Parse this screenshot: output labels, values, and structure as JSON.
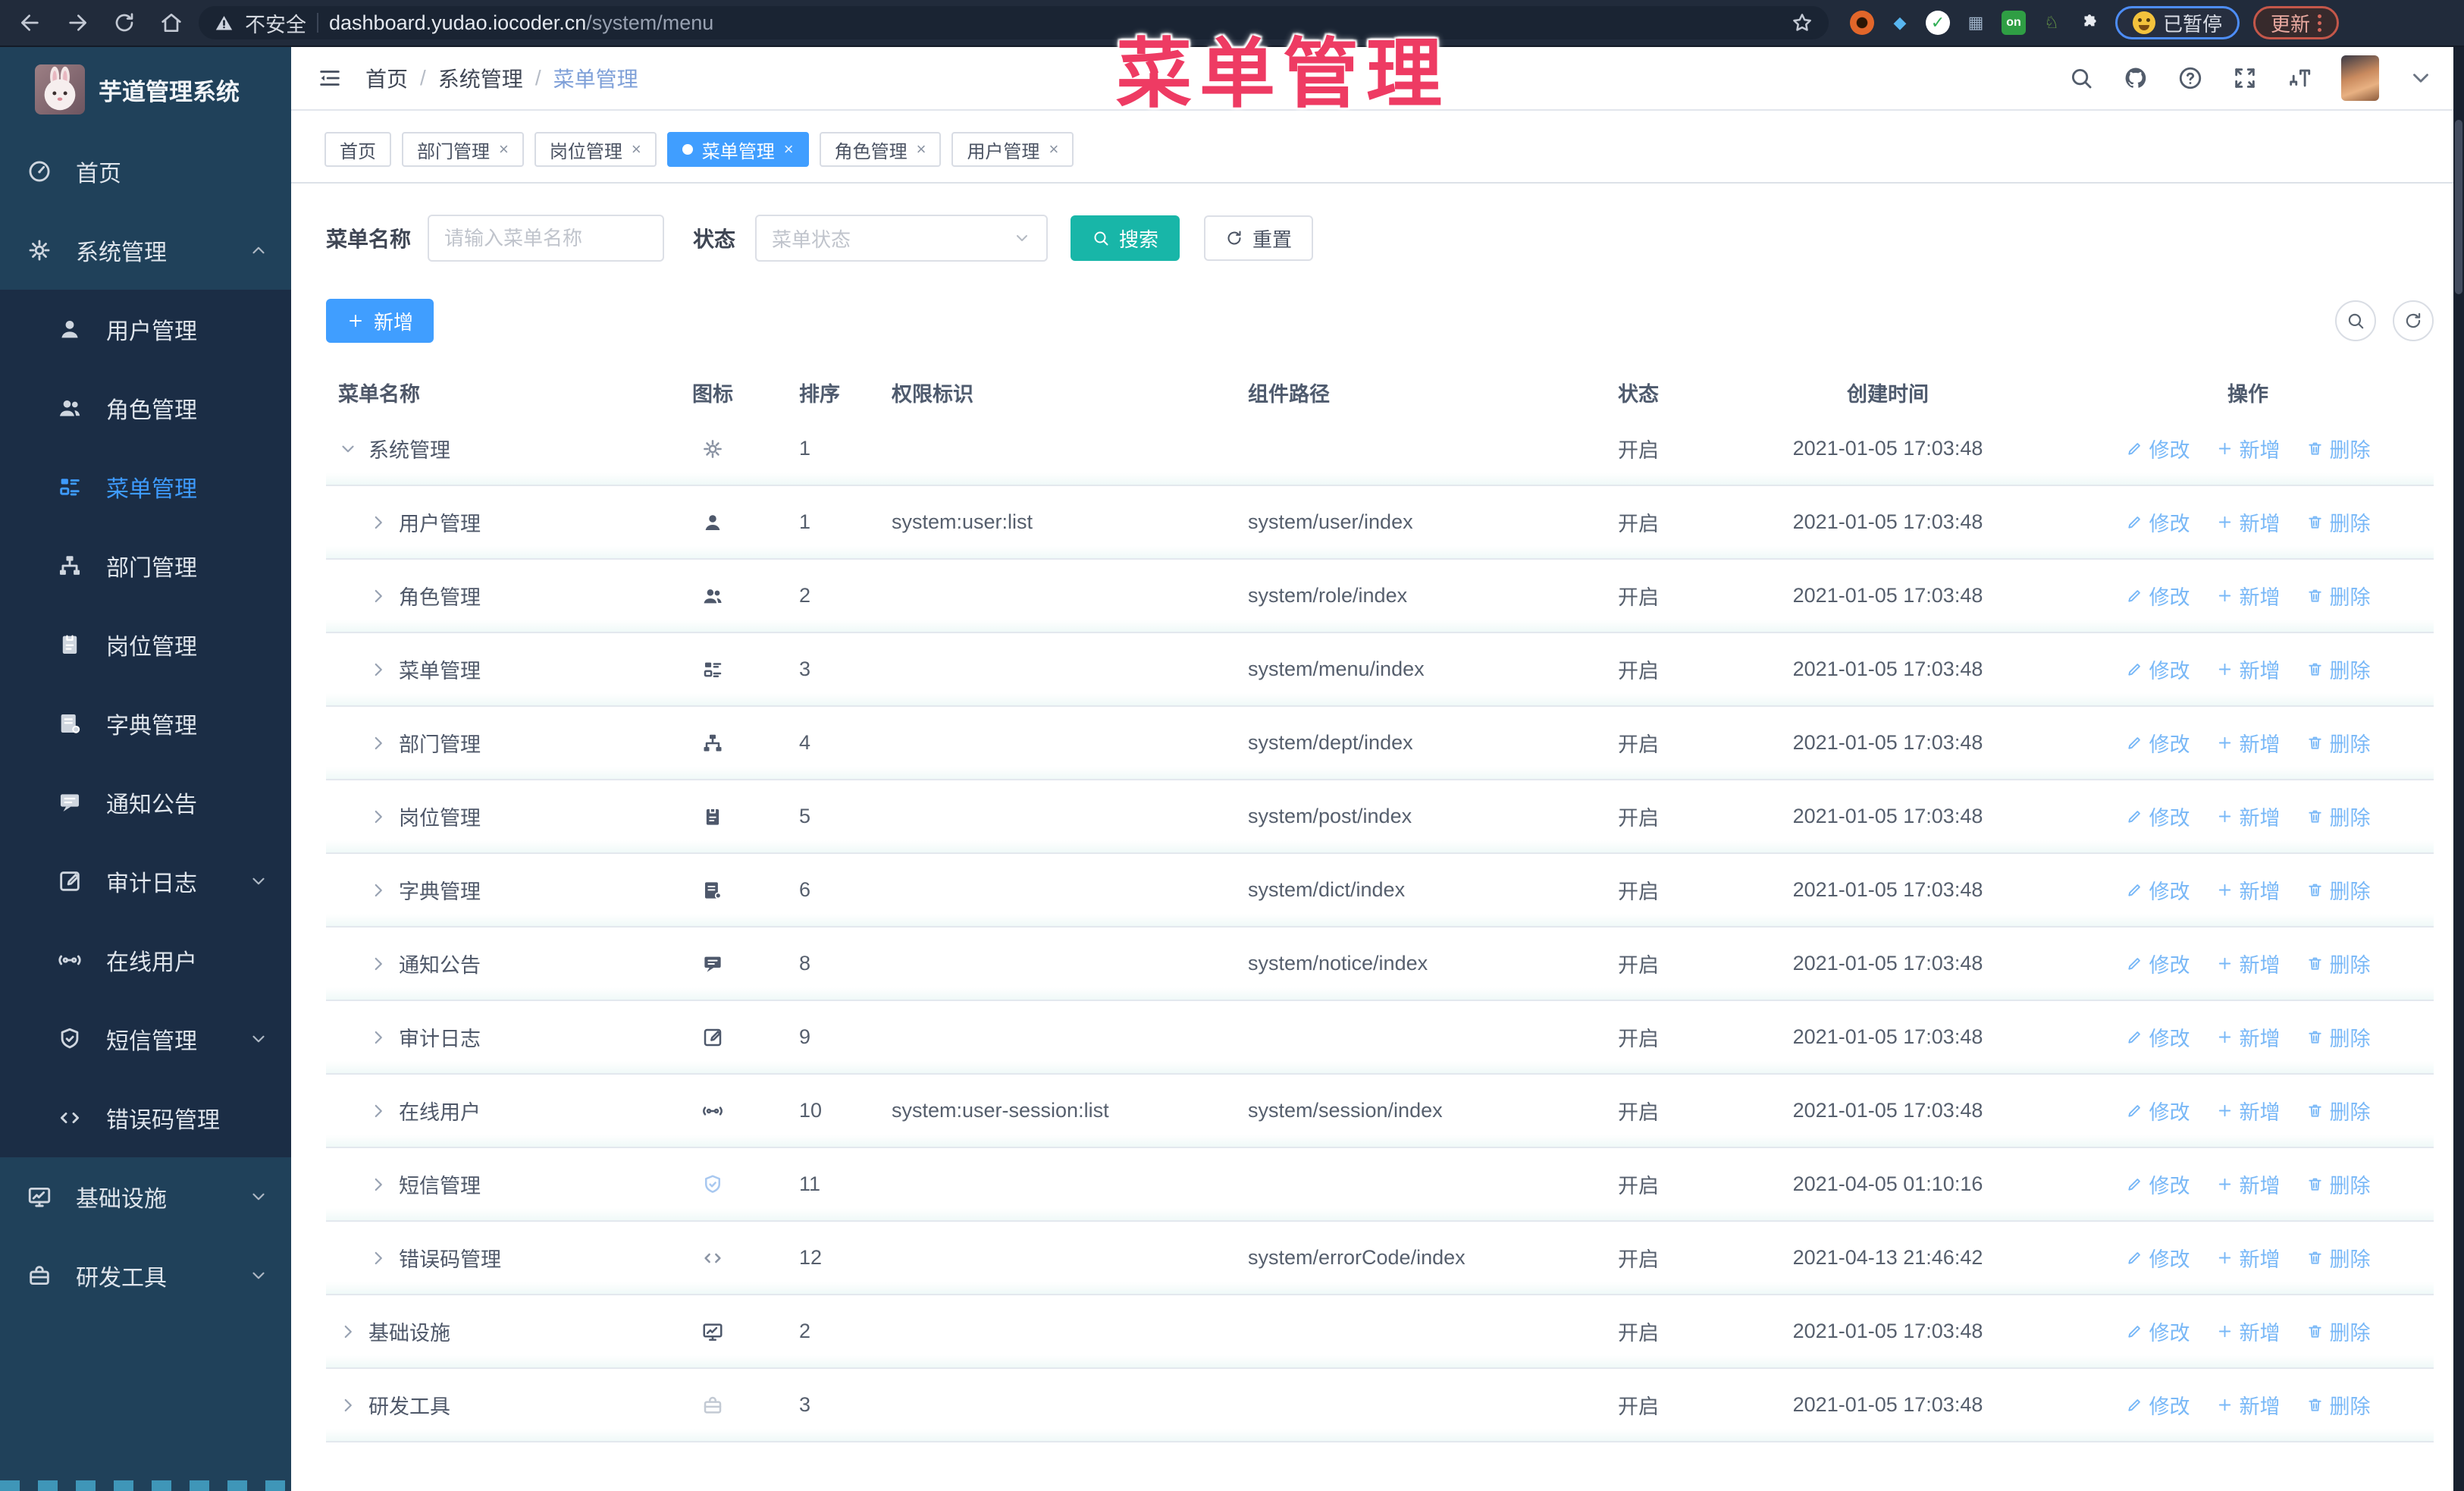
{
  "overlay_title": "菜单管理",
  "colors": {
    "accent_blue": "#409eff",
    "search_teal": "#18b6a8",
    "overlay_red": "#ee3b63",
    "sidebar_bg": "#20415a",
    "submenu_bg": "#1b2d45",
    "active_menu_text": "#3e9bff"
  },
  "browser": {
    "security_label": "不安全",
    "url_host": "dashboard.yudao.iocoder.cn",
    "url_path": "/system/menu",
    "on_badge": "on",
    "paused_badge": "已暂停",
    "update_badge": "更新"
  },
  "sidebar": {
    "app_title": "芋道管理系统",
    "menu": [
      {
        "key": "home",
        "label": "首页",
        "icon": "gauge",
        "level": 0
      },
      {
        "key": "system",
        "label": "系统管理",
        "icon": "gear",
        "level": 0,
        "chevron": "up",
        "expanded": true
      },
      {
        "key": "user",
        "label": "用户管理",
        "icon": "user",
        "level": 1
      },
      {
        "key": "role",
        "label": "角色管理",
        "icon": "users",
        "level": 1
      },
      {
        "key": "menu",
        "label": "菜单管理",
        "icon": "menu",
        "level": 1,
        "active": true
      },
      {
        "key": "dept",
        "label": "部门管理",
        "icon": "tree",
        "level": 1
      },
      {
        "key": "post",
        "label": "岗位管理",
        "icon": "badge",
        "level": 1
      },
      {
        "key": "dict",
        "label": "字典管理",
        "icon": "book",
        "level": 1
      },
      {
        "key": "notice",
        "label": "通知公告",
        "icon": "notice",
        "level": 1
      },
      {
        "key": "auditlog",
        "label": "审计日志",
        "icon": "log",
        "level": 1,
        "chevron": "down"
      },
      {
        "key": "online",
        "label": "在线用户",
        "icon": "link",
        "level": 1
      },
      {
        "key": "sms",
        "label": "短信管理",
        "icon": "shield",
        "level": 1,
        "chevron": "down"
      },
      {
        "key": "errorcode",
        "label": "错误码管理",
        "icon": "code",
        "level": 1
      },
      {
        "key": "infra",
        "label": "基础设施",
        "icon": "monitor",
        "level": 0,
        "chevron": "down"
      },
      {
        "key": "devtool",
        "label": "研发工具",
        "icon": "toolbox",
        "level": 0,
        "chevron": "down"
      }
    ]
  },
  "header": {
    "breadcrumb": [
      "首页",
      "系统管理",
      "菜单管理"
    ]
  },
  "tabs": [
    {
      "key": "home",
      "label": "首页",
      "closable": false,
      "active": false
    },
    {
      "key": "dept",
      "label": "部门管理",
      "closable": true,
      "active": false
    },
    {
      "key": "post",
      "label": "岗位管理",
      "closable": true,
      "active": false
    },
    {
      "key": "menu",
      "label": "菜单管理",
      "closable": true,
      "active": true
    },
    {
      "key": "role",
      "label": "角色管理",
      "closable": true,
      "active": false
    },
    {
      "key": "user",
      "label": "用户管理",
      "closable": true,
      "active": false
    }
  ],
  "filters": {
    "name_label": "菜单名称",
    "name_placeholder": "请输入菜单名称",
    "name_value": "",
    "status_label": "状态",
    "status_placeholder": "菜单状态",
    "search_label": "搜索",
    "reset_label": "重置"
  },
  "toolbar": {
    "add_label": "新增"
  },
  "table": {
    "columns": [
      "菜单名称",
      "图标",
      "排序",
      "权限标识",
      "组件路径",
      "状态",
      "创建时间",
      "操作"
    ],
    "actions": {
      "edit": "修改",
      "add": "新增",
      "delete": "删除"
    },
    "rows": [
      {
        "key": "system",
        "name": "系统管理",
        "icon": "gear",
        "tone": "tone-light",
        "level": 0,
        "expand": "down",
        "sort": "1",
        "perm": "",
        "path": "",
        "status": "开启",
        "created": "2021-01-05 17:03:48"
      },
      {
        "key": "user",
        "name": "用户管理",
        "icon": "user",
        "tone": "",
        "level": 1,
        "expand": "right",
        "sort": "1",
        "perm": "system:user:list",
        "path": "system/user/index",
        "status": "开启",
        "created": "2021-01-05 17:03:48"
      },
      {
        "key": "role",
        "name": "角色管理",
        "icon": "users",
        "tone": "",
        "level": 1,
        "expand": "right",
        "sort": "2",
        "perm": "",
        "path": "system/role/index",
        "status": "开启",
        "created": "2021-01-05 17:03:48"
      },
      {
        "key": "menu",
        "name": "菜单管理",
        "icon": "menu",
        "tone": "",
        "level": 1,
        "expand": "right",
        "sort": "3",
        "perm": "",
        "path": "system/menu/index",
        "status": "开启",
        "created": "2021-01-05 17:03:48"
      },
      {
        "key": "dept",
        "name": "部门管理",
        "icon": "tree",
        "tone": "",
        "level": 1,
        "expand": "right",
        "sort": "4",
        "perm": "",
        "path": "system/dept/index",
        "status": "开启",
        "created": "2021-01-05 17:03:48"
      },
      {
        "key": "post",
        "name": "岗位管理",
        "icon": "badge",
        "tone": "",
        "level": 1,
        "expand": "right",
        "sort": "5",
        "perm": "",
        "path": "system/post/index",
        "status": "开启",
        "created": "2021-01-05 17:03:48"
      },
      {
        "key": "dict",
        "name": "字典管理",
        "icon": "book",
        "tone": "",
        "level": 1,
        "expand": "right",
        "sort": "6",
        "perm": "",
        "path": "system/dict/index",
        "status": "开启",
        "created": "2021-01-05 17:03:48"
      },
      {
        "key": "notice",
        "name": "通知公告",
        "icon": "notice",
        "tone": "",
        "level": 1,
        "expand": "right",
        "sort": "8",
        "perm": "",
        "path": "system/notice/index",
        "status": "开启",
        "created": "2021-01-05 17:03:48"
      },
      {
        "key": "auditlog",
        "name": "审计日志",
        "icon": "log",
        "tone": "",
        "level": 1,
        "expand": "right",
        "sort": "9",
        "perm": "",
        "path": "",
        "status": "开启",
        "created": "2021-01-05 17:03:48"
      },
      {
        "key": "online",
        "name": "在线用户",
        "icon": "link",
        "tone": "",
        "level": 1,
        "expand": "right",
        "sort": "10",
        "perm": "system:user-session:list",
        "path": "system/session/index",
        "status": "开启",
        "created": "2021-01-05 17:03:48"
      },
      {
        "key": "sms",
        "name": "短信管理",
        "icon": "shield",
        "tone": "tone-blue",
        "level": 1,
        "expand": "right",
        "sort": "11",
        "perm": "",
        "path": "",
        "status": "开启",
        "created": "2021-04-05 01:10:16"
      },
      {
        "key": "errorcode",
        "name": "错误码管理",
        "icon": "code",
        "tone": "tone-light",
        "level": 1,
        "expand": "right",
        "sort": "12",
        "perm": "",
        "path": "system/errorCode/index",
        "status": "开启",
        "created": "2021-04-13 21:46:42"
      },
      {
        "key": "infra",
        "name": "基础设施",
        "icon": "monitor",
        "tone": "",
        "level": 0,
        "expand": "right",
        "sort": "2",
        "perm": "",
        "path": "",
        "status": "开启",
        "created": "2021-01-05 17:03:48"
      },
      {
        "key": "devtool",
        "name": "研发工具",
        "icon": "toolbox",
        "tone": "tone-faint",
        "level": 0,
        "expand": "right",
        "sort": "3",
        "perm": "",
        "path": "",
        "status": "开启",
        "created": "2021-01-05 17:03:48"
      }
    ]
  }
}
